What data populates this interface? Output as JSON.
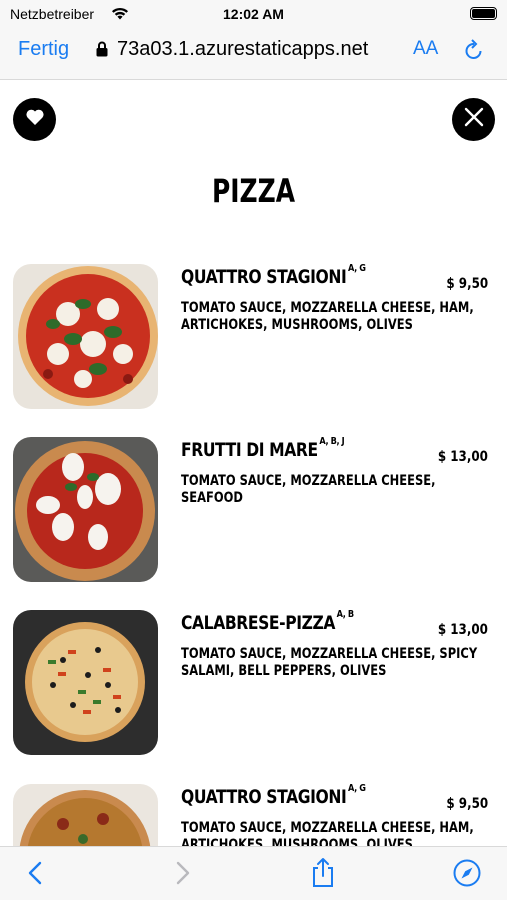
{
  "status_bar": {
    "carrier": "Netzbetreiber",
    "time": "12:02 AM"
  },
  "browser": {
    "done_label": "Fertig",
    "url": "73a03.1.azurestaticapps.net",
    "text_size_label": "AA"
  },
  "page": {
    "title": "PIZZA"
  },
  "menu": {
    "items": [
      {
        "name": "QUATTRO STAGIONI",
        "allergens": "A, G",
        "price": "$ 9,50",
        "description": "TOMATO SAUCE, MOZZARELLA CHEESE, HAM, ARTICHOKES, MUSHROOMS, OLIVES"
      },
      {
        "name": "FRUTTI DI MARE",
        "allergens": "A, B, J",
        "price": "$ 13,00",
        "description": "TOMATO SAUCE, MOZZARELLA CHEESE, SEAFOOD"
      },
      {
        "name": "CALABRESE-PIZZA",
        "allergens": "A, B",
        "price": "$ 13,00",
        "description": "TOMATO SAUCE, MOZZARELLA CHEESE, SPICY SALAMI, BELL PEPPERS, OLIVES"
      },
      {
        "name": "QUATTRO STAGIONI",
        "allergens": "A, G",
        "price": "$ 9,50",
        "description": "TOMATO SAUCE, MOZZARELLA CHEESE, HAM, ARTICHOKES, MUSHROOMS, OLIVES"
      }
    ]
  },
  "colors": {
    "accent": "#1a7cf1",
    "button_bg": "#000000"
  },
  "icons": {
    "favorite": "heart-icon",
    "close": "close-icon",
    "back": "chevron-left-icon",
    "forward": "chevron-right-icon",
    "share": "share-icon",
    "browser": "compass-icon"
  }
}
